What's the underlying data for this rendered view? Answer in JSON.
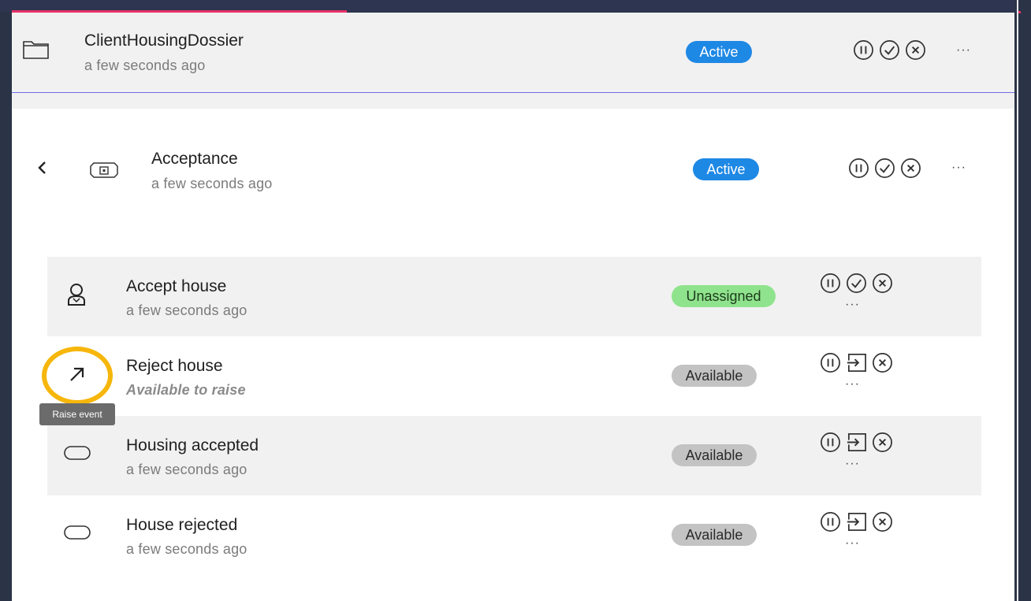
{
  "dossier": {
    "title": "ClientHousingDossier",
    "time": "a few seconds ago",
    "status": "Active",
    "more": "···"
  },
  "stage": {
    "title": "Acceptance",
    "time": "a few seconds ago",
    "status": "Active",
    "more": "···"
  },
  "items": [
    {
      "title": "Accept house",
      "sub": "a few seconds ago",
      "status": "Unassigned",
      "more": "···"
    },
    {
      "title": "Reject house",
      "sub": "Available to raise",
      "status": "Available",
      "more": "···"
    },
    {
      "title": "Housing accepted",
      "sub": "a few seconds ago",
      "status": "Available",
      "more": "···"
    },
    {
      "title": "House rejected",
      "sub": "a few seconds ago",
      "status": "Available",
      "more": "···"
    }
  ],
  "tooltip": "Raise event",
  "icons": {
    "dossier": "folder-icon",
    "back": "chevron-left-icon",
    "stage": "stage-icon",
    "accept_house": "user-icon",
    "reject_house": "arrow-up-right-icon",
    "milestone": "milestone-icon",
    "pause": "pause-icon",
    "complete": "check-icon",
    "terminate": "close-icon",
    "start": "enter-icon"
  },
  "colors": {
    "active": "#1e88e5",
    "unassigned": "#8fe38c",
    "available": "#c3c3c3",
    "highlight": "#f6b60b",
    "progress": "#e8336a"
  }
}
